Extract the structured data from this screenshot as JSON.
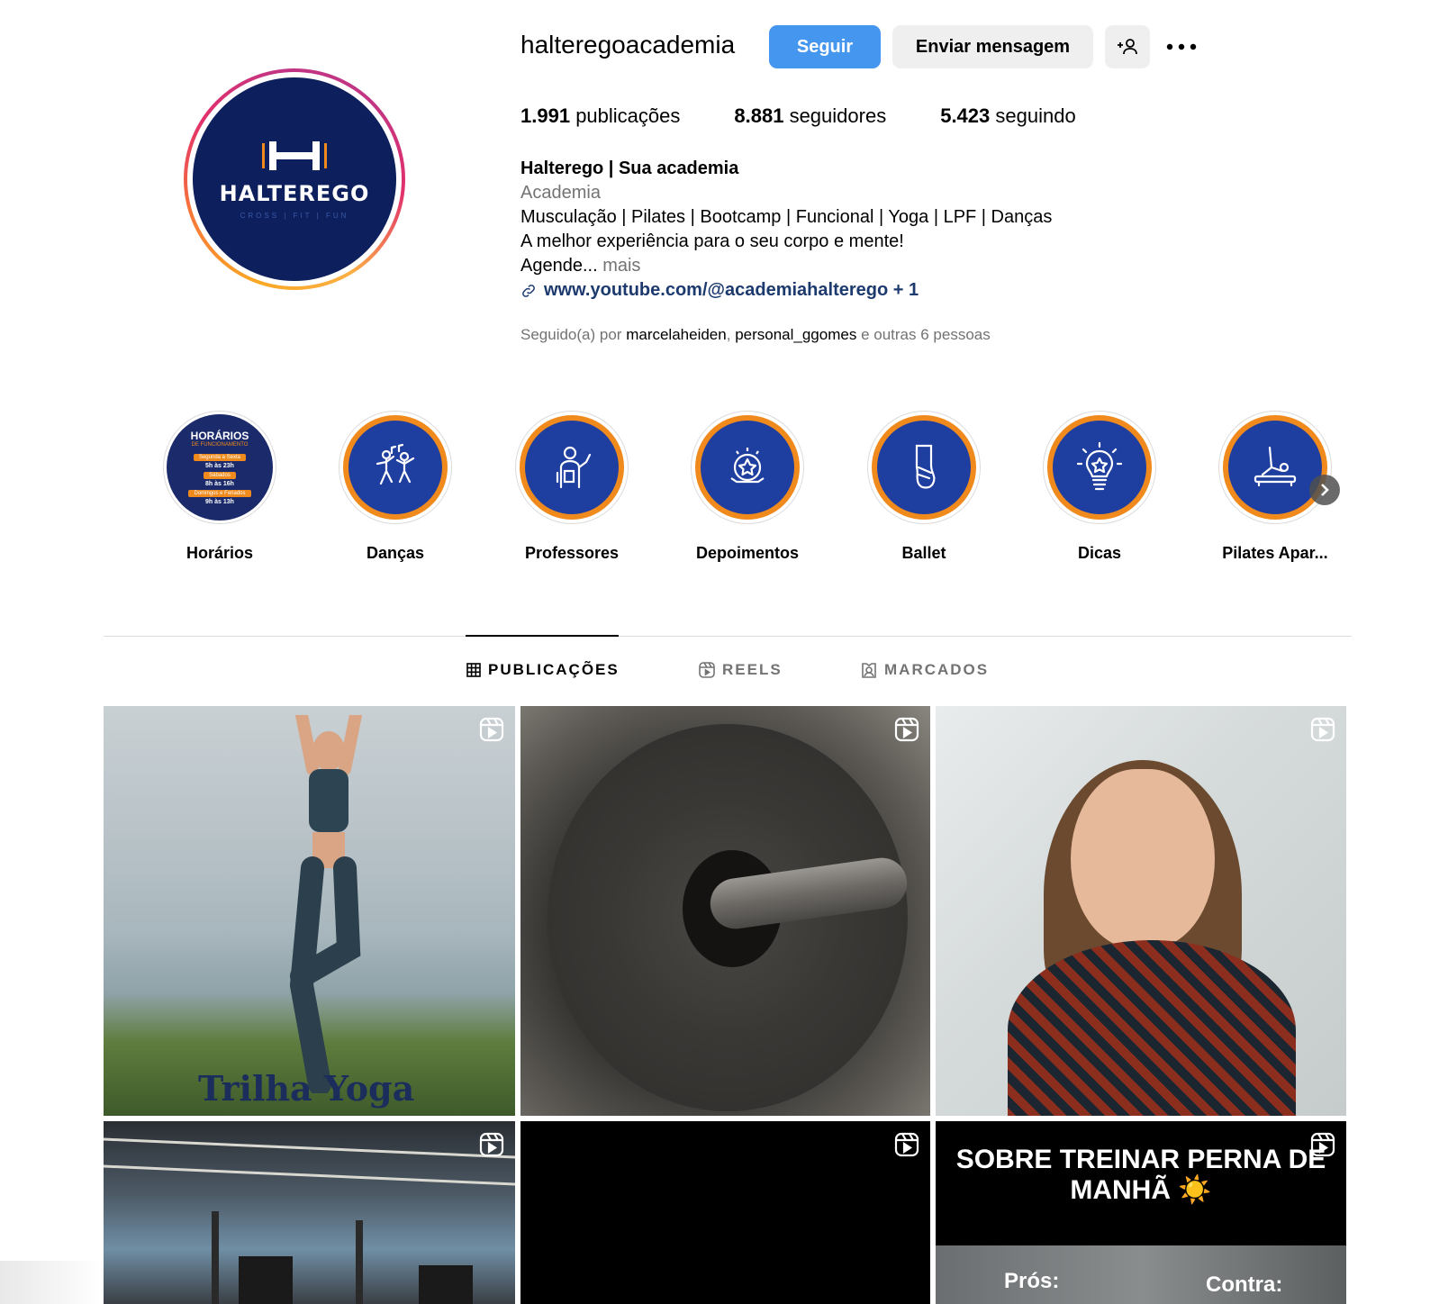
{
  "profile": {
    "username": "halteregoacademia",
    "follow_label": "Seguir",
    "message_label": "Enviar mensagem",
    "avatar": {
      "brand": "HALTEREGO",
      "tagline": "CROSS | FIT | FUN"
    },
    "stats": {
      "posts_count": "1.991",
      "posts_label": "publicações",
      "followers_count": "8.881",
      "followers_label": "seguidores",
      "following_count": "5.423",
      "following_label": "seguindo"
    },
    "bio": {
      "name": "Halterego | Sua academia",
      "category": "Academia",
      "line1": "Musculação | Pilates | Bootcamp | Funcional | Yoga | LPF | Danças",
      "line2": "A melhor experiência para o seu corpo e mente!",
      "line3": "Agende...",
      "more": "mais",
      "link": "www.youtube.com/@academiahalterego + 1"
    },
    "followed_by": {
      "prefix": "Seguido(a) por",
      "user1": "marcelaheiden",
      "sep": ",",
      "user2": "personal_ggomes",
      "suffix": "e outras 6 pessoas"
    }
  },
  "highlights": [
    {
      "label": "Horários",
      "icon": "schedule-cover",
      "cover": {
        "title": "HORÁRIOS",
        "subtitle": "DE FUNCIONAMENTO",
        "rows": [
          {
            "day": "Segunda a Sexta",
            "hours": "5h às 23h"
          },
          {
            "day": "Sábados",
            "hours": "8h às 16h"
          },
          {
            "day": "Domingos e Feriados",
            "hours": "9h às 13h"
          }
        ]
      }
    },
    {
      "label": "Danças",
      "icon": "dancers-icon"
    },
    {
      "label": "Professores",
      "icon": "trainer-icon"
    },
    {
      "label": "Depoimentos",
      "icon": "star-badge-icon"
    },
    {
      "label": "Ballet",
      "icon": "ballet-shoe-icon"
    },
    {
      "label": "Dicas",
      "icon": "lightbulb-icon"
    },
    {
      "label": "Pilates Apar...",
      "icon": "pilates-icon"
    }
  ],
  "tabs": [
    {
      "label": "PUBLICAÇÕES",
      "icon": "grid-icon",
      "active": true
    },
    {
      "label": "REELS",
      "icon": "reels-icon",
      "active": false
    },
    {
      "label": "MARCADOS",
      "icon": "tagged-icon",
      "active": false
    }
  ],
  "posts": [
    {
      "type": "reel",
      "overlay_text": "Trilha Yoga"
    },
    {
      "type": "reel",
      "overlay_text": ""
    },
    {
      "type": "reel",
      "overlay_text": ""
    },
    {
      "type": "reel",
      "overlay_text": ""
    },
    {
      "type": "reel",
      "overlay_text": ""
    },
    {
      "type": "reel",
      "overlay_text": "SOBRE TREINAR PERNA DE MANHÃ ☀️",
      "pros": "Prós:",
      "contra": "Contra:"
    }
  ],
  "colors": {
    "follow_button": "#4596ef",
    "brand_navy": "#0d1f5c",
    "highlight_orange": "#f08a1c",
    "highlight_blue": "#1f3fa0"
  }
}
